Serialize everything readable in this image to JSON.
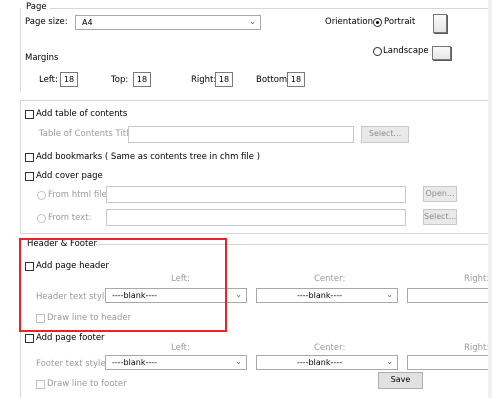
{
  "page": {
    "title": "Page",
    "size_label": "Page size:",
    "size_value": "A4",
    "orientation_label": "Orientation:",
    "portrait_label": "Portrait",
    "landscape_label": "Landscape",
    "selected_orientation": "Portrait"
  },
  "margins": {
    "title": "Margins",
    "left_label": "Left:",
    "left_value": "18",
    "top_label": "Top:",
    "top_value": "18",
    "right_label": "Right:",
    "right_value": "18",
    "bottom_label": "Bottom:",
    "bottom_value": "18"
  },
  "toc": {
    "checkbox_label": "Add table of contents",
    "title_label": "Table of Contents Title",
    "title_value": "",
    "select_button": "Select..."
  },
  "bookmarks": {
    "checkbox_label": "Add  bookmarks ( Same as contents tree in chm file )"
  },
  "cover": {
    "checkbox_label": "Add cover page",
    "html_label": "From html file:",
    "html_value": "",
    "open_button": "Open...",
    "text_label": "From  text:",
    "text_value": "",
    "select_button": "Select..."
  },
  "header_footer": {
    "title": "Header & Footer"
  },
  "header": {
    "checkbox_label": "Add page header",
    "left_label": "Left:",
    "center_label": "Center:",
    "right_label": "Right:",
    "style_label": "Header text style:",
    "left_value": "----blank----",
    "center_value": "----blank----",
    "draw_line_label": "Draw line to header"
  },
  "footer": {
    "checkbox_label": "Add page footer",
    "left_label": "Left:",
    "center_label": "Center:",
    "right_label": "Right:",
    "style_label": "Footer text style:",
    "left_value": "----blank----",
    "center_value": "----blank----",
    "draw_line_label": "Draw line to footer"
  },
  "save_button": "Save",
  "colors": {
    "highlight": "#e8232a",
    "disabled_text": "#9a9a9a",
    "border": "#d7d7d7"
  }
}
